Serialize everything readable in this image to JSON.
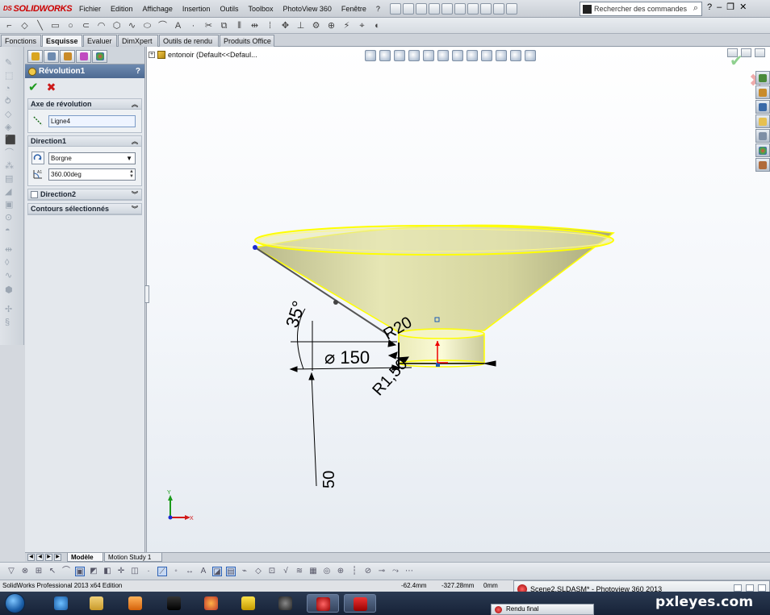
{
  "app": {
    "logo_text": "SOLIDWORKS",
    "logo_prefix": "DS"
  },
  "menu": [
    "Fichier",
    "Edition",
    "Affichage",
    "Insertion",
    "Outils",
    "Toolbox",
    "PhotoView 360",
    "Fenêtre",
    "?"
  ],
  "search": {
    "placeholder": "Rechercher des commandes"
  },
  "command_tabs": [
    "Fonctions",
    "Esquisse",
    "Evaluer",
    "DimXpert",
    "Outils de rendu",
    "Produits Office"
  ],
  "active_command_tab": "Esquisse",
  "property_manager": {
    "title": "Révolution1",
    "help": "?",
    "ok_glyph": "✔",
    "cancel_glyph": "✖",
    "axis_group": {
      "title": "Axe de révolution",
      "value": "Ligne4"
    },
    "direction1_group": {
      "title": "Direction1",
      "type_selected": "Borgne",
      "angle": "360.00deg"
    },
    "direction2_group": {
      "title": "Direction2"
    },
    "contours_group": {
      "title": "Contours sélectionnés"
    }
  },
  "tree": {
    "root_label": "entonoir  (Default<<Defaul..."
  },
  "sketch": {
    "dim_angle": "35°",
    "dim_radius_top": "R20",
    "dim_diameter": "⌀ 150",
    "dim_radius_bottom": "R1,50",
    "dim_length": "50",
    "axis_y": "Y",
    "axis_x": "X"
  },
  "bottom_tabs": [
    "Modèle",
    "Motion Study 1"
  ],
  "active_bottom_tab": "Modèle",
  "status": {
    "edition": "SolidWorks Professional 2013 x64 Edition",
    "x": "-62.4mm",
    "y": "-327.28mm",
    "z": "0mm"
  },
  "photoview_window": {
    "title": "Scene2.SLDASM* - Photoview 360 2013"
  },
  "taskbar_popup": {
    "label": "Rendu final"
  },
  "watermark": {
    "text": "pxleyes.com"
  },
  "colors": {
    "model_fill": "#dcdca0",
    "model_edge": "#ffff00",
    "dimension": "#000000",
    "pm_title_bg": "#5b789f",
    "ok_green": "#1d9a1d",
    "cancel_red": "#cc1a1a"
  }
}
